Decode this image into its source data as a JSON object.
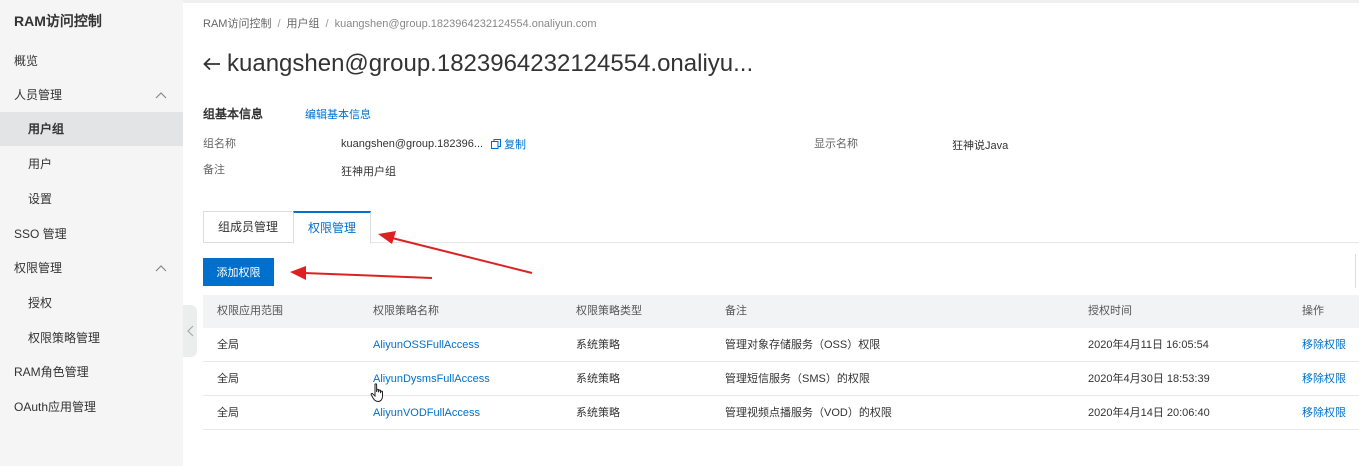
{
  "sidebar": {
    "title": "RAM访问控制",
    "items": [
      {
        "label": "概览"
      },
      {
        "label": "人员管理"
      },
      {
        "label": "用户组"
      },
      {
        "label": "用户"
      },
      {
        "label": "设置"
      },
      {
        "label": "SSO 管理"
      },
      {
        "label": "权限管理"
      },
      {
        "label": "授权"
      },
      {
        "label": "权限策略管理"
      },
      {
        "label": "RAM角色管理"
      },
      {
        "label": "OAuth应用管理"
      }
    ]
  },
  "breadcrumb": {
    "items": [
      "RAM访问控制",
      "用户组",
      "kuangshen@group.1823964232124554.onaliyun.com"
    ],
    "separator": "/"
  },
  "header": {
    "title": "kuangshen@group.1823964232124554.onaliyu..."
  },
  "basic_info": {
    "heading": "组基本信息",
    "edit_label": "编辑基本信息",
    "group_name_label": "组名称",
    "group_name_value": "kuangshen@group.182396...",
    "copy_label": "复制",
    "display_name_label": "显示名称",
    "display_name_value": "狂神说Java",
    "note_label": "备注",
    "note_value": "狂神用户组"
  },
  "tabs": [
    {
      "label": "组成员管理"
    },
    {
      "label": "权限管理"
    }
  ],
  "add_permission_label": "添加权限",
  "table": {
    "headers": [
      "权限应用范围",
      "权限策略名称",
      "权限策略类型",
      "备注",
      "授权时间",
      "操作"
    ],
    "rows": [
      {
        "scope": "全局",
        "policy": "AliyunOSSFullAccess",
        "type": "系统策略",
        "note": "管理对象存储服务（OSS）权限",
        "time": "2020年4月11日 16:05:54",
        "action": "移除权限"
      },
      {
        "scope": "全局",
        "policy": "AliyunDysmsFullAccess",
        "type": "系统策略",
        "note": "管理短信服务（SMS）的权限",
        "time": "2020年4月30日 18:53:39",
        "action": "移除权限"
      },
      {
        "scope": "全局",
        "policy": "AliyunVODFullAccess",
        "type": "系统策略",
        "note": "管理视频点播服务（VOD）的权限",
        "time": "2020年4月14日 20:06:40",
        "action": "移除权限"
      }
    ]
  },
  "colors": {
    "accent": "#0070cc",
    "annotation_arrow": "#e02020",
    "sidebar_bg": "#f5f5f6"
  }
}
